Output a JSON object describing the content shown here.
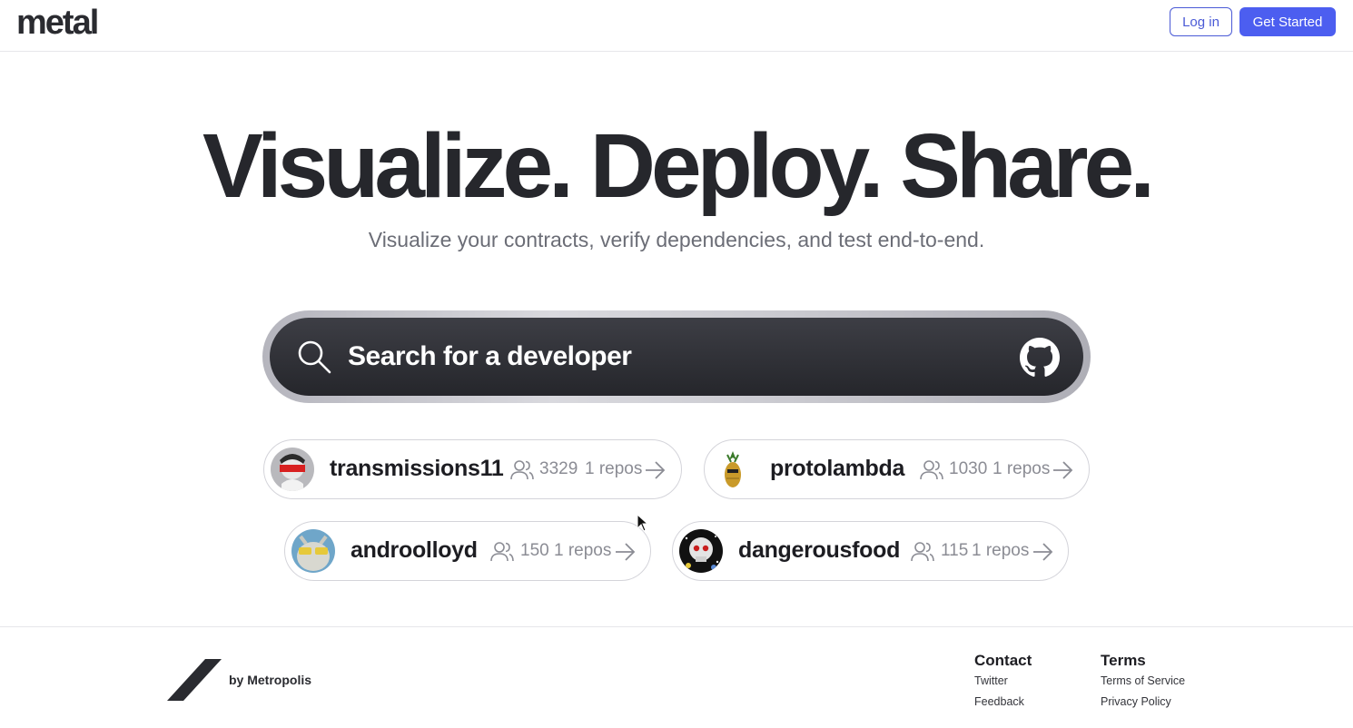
{
  "header": {
    "logo": "metal",
    "login_label": "Log in",
    "get_started_label": "Get Started",
    "accent_color": "#4c5ef0"
  },
  "hero": {
    "headline": "Visualize. Deploy. Share.",
    "subline": "Visualize your contracts, verify dependencies, and test end-to-end."
  },
  "search": {
    "placeholder": "Search for a developer",
    "icon": "search-icon",
    "right_icon": "github-icon"
  },
  "developers": [
    {
      "name": "transmissions11",
      "followers": "3329",
      "repos": "1 repos"
    },
    {
      "name": "protolambda",
      "followers": "1030",
      "repos": "1 repos"
    },
    {
      "name": "androolloyd",
      "followers": "150",
      "repos": "1 repos"
    },
    {
      "name": "dangerousfood",
      "followers": "115",
      "repos": "1 repos"
    }
  ],
  "footer": {
    "by_label": "by Metropolis",
    "contact": {
      "heading": "Contact",
      "links": [
        "Twitter",
        "Feedback"
      ]
    },
    "terms": {
      "heading": "Terms",
      "links": [
        "Terms of Service",
        "Privacy Policy"
      ]
    }
  }
}
